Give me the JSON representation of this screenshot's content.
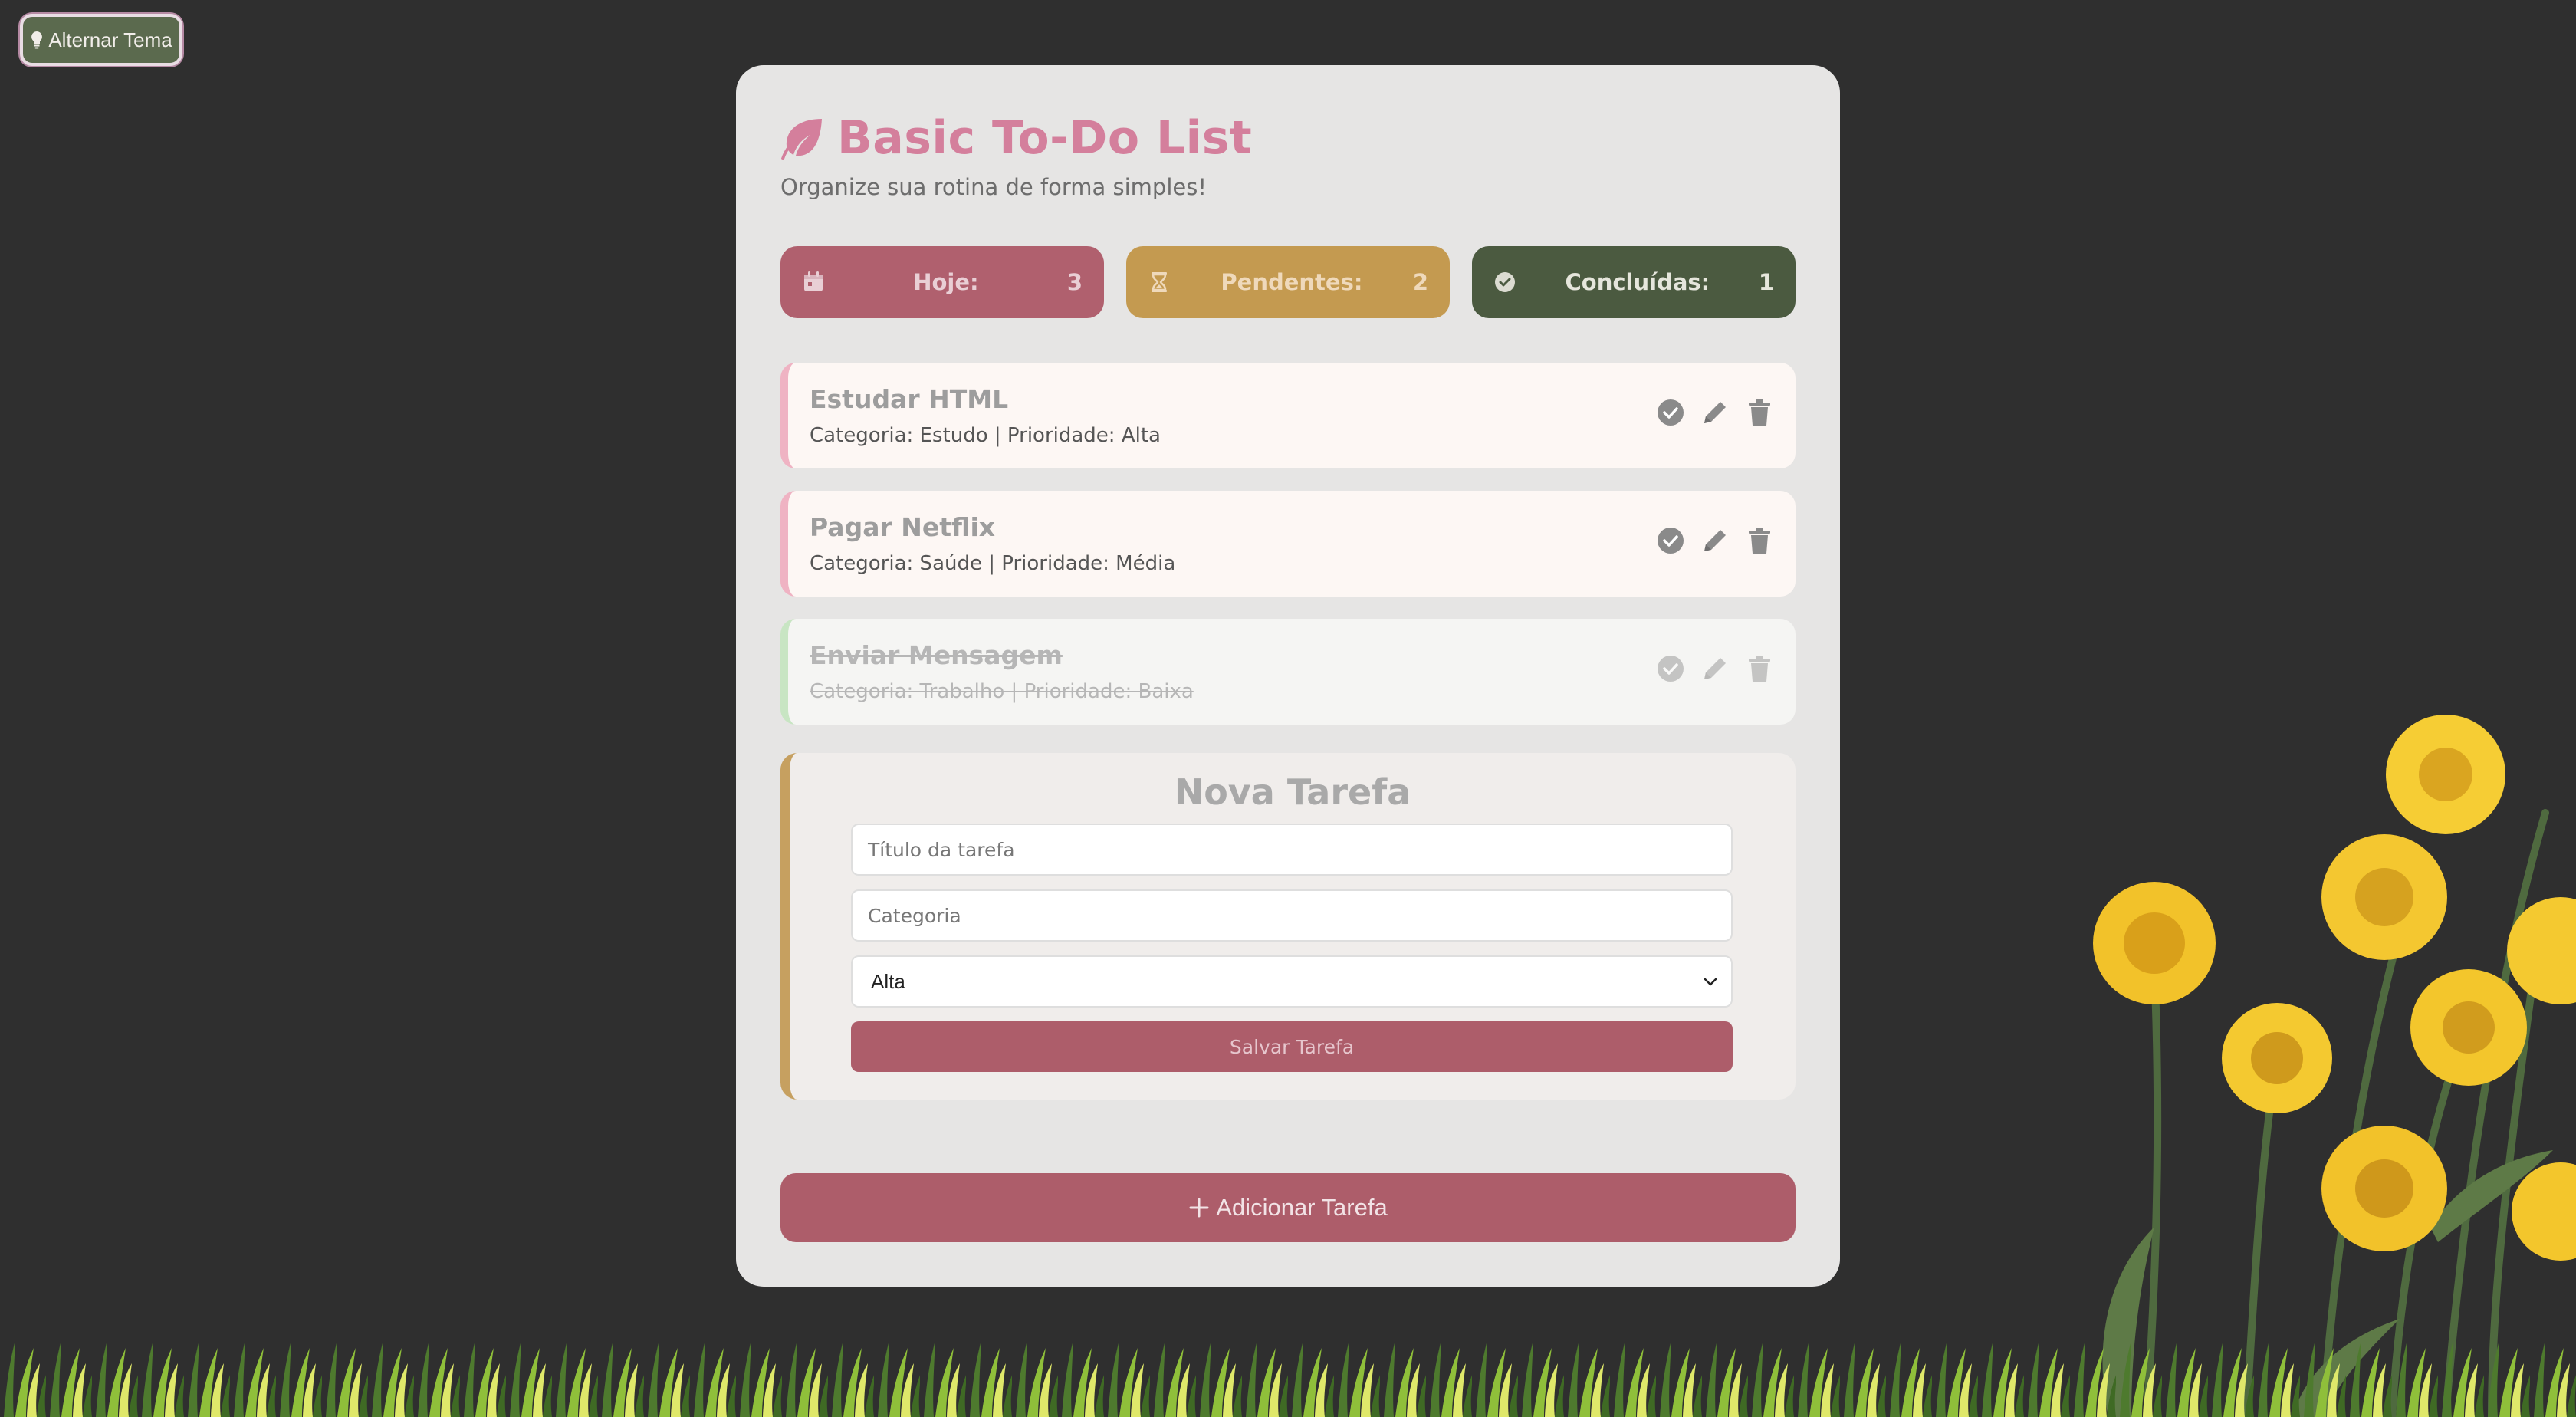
{
  "theme_toggle": {
    "label": "Alternar Tema",
    "icon": "lightbulb-icon"
  },
  "header": {
    "icon": "leaf-icon",
    "title": "Basic To-Do List",
    "subtitle": "Organize sua rotina de forma simples!"
  },
  "stats": {
    "today": {
      "label": "Hoje:",
      "value": "3",
      "icon": "calendar-icon",
      "color": "#b0606e"
    },
    "pending": {
      "label": "Pendentes:",
      "value": "2",
      "icon": "hourglass-icon",
      "color": "#c49a50"
    },
    "done": {
      "label": "Concluídas:",
      "value": "1",
      "icon": "check-circle-icon",
      "color": "#4b5a40"
    }
  },
  "tasks": [
    {
      "title": "Estudar HTML",
      "meta": "Categoria: Estudo | Prioridade: Alta",
      "completed": false
    },
    {
      "title": "Pagar Netflix",
      "meta": "Categoria: Saúde | Prioridade: Média",
      "completed": false
    },
    {
      "title": "Enviar Mensagem",
      "meta": "Categoria: Trabalho | Prioridade: Baixa",
      "completed": true
    }
  ],
  "form": {
    "title": "Nova Tarefa",
    "title_placeholder": "Título da tarefa",
    "category_placeholder": "Categoria",
    "priority_selected": "Alta",
    "save_label": "Salvar Tarefa"
  },
  "add_button": {
    "label": "Adicionar Tarefa",
    "icon": "plus-icon"
  },
  "colors": {
    "accent": "#d47f9c",
    "button": "#ad5d6a",
    "background": "#2f2f2f",
    "card": "#e6e5e4"
  }
}
